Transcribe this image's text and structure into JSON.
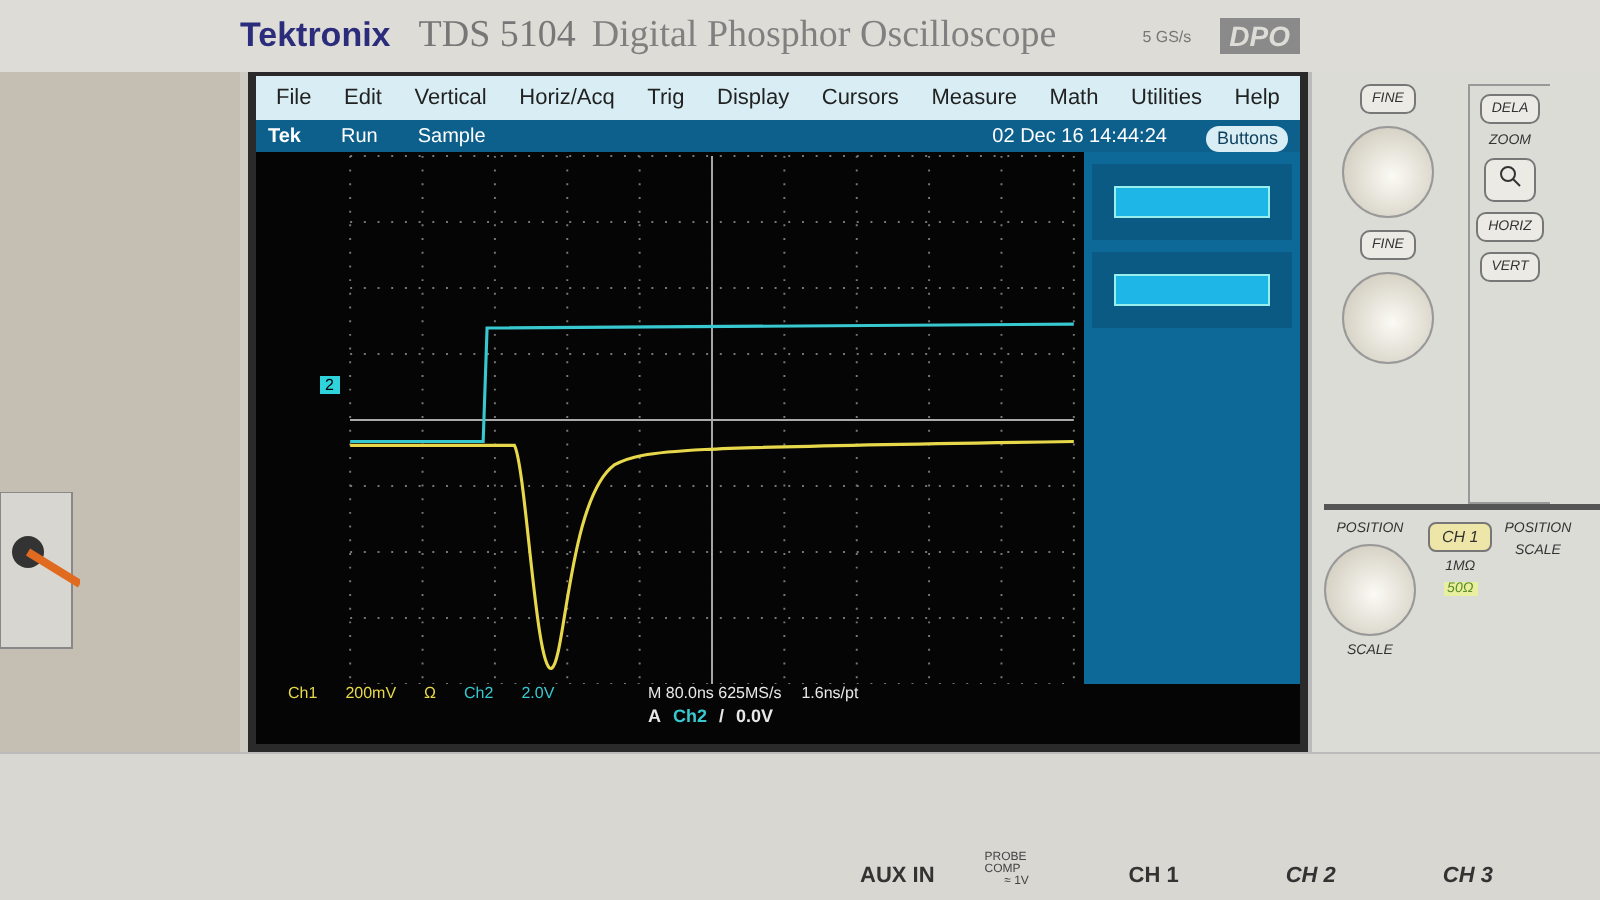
{
  "brand": {
    "logo": "Tektronix",
    "model": "TDS 5104",
    "title": "Digital Phosphor Oscilloscope",
    "rate": "5 GS/s",
    "badge": "DPO"
  },
  "menu": [
    "File",
    "Edit",
    "Vertical",
    "Horiz/Acq",
    "Trig",
    "Display",
    "Cursors",
    "Measure",
    "Math",
    "Utilities",
    "Help"
  ],
  "status": {
    "label": "Tek",
    "run": "Run",
    "mode": "Sample",
    "datetime": "02 Dec 16 14:44:24",
    "toggle": "Buttons"
  },
  "channel_marker": {
    "label": "2",
    "color": "#2fd3dc"
  },
  "traces": [
    {
      "kind": "step",
      "color": "#38c8d0"
    },
    {
      "kind": "pulse",
      "color": "#e6d84a"
    }
  ],
  "readout": {
    "vertical": [
      {
        "text": "Ch1",
        "color": "#e6d84a"
      },
      {
        "text": "200mV",
        "color": "#e6d84a"
      },
      {
        "text": "Ω",
        "color": "#e6d84a"
      },
      {
        "text": "Ch2",
        "color": "#38c8d0"
      },
      {
        "text": "2.0V",
        "color": "#38c8d0"
      }
    ],
    "timebase": [
      "M 80.0ns 625MS/s",
      "1.6ns/pt"
    ],
    "trigger": [
      {
        "text": "A",
        "color": "#e8e8e8"
      },
      {
        "text": "Ch2",
        "color": "#38c8d0"
      },
      {
        "text": "/",
        "color": "#e8e8e8"
      },
      {
        "text": "0.0V",
        "color": "#e8e8e8"
      }
    ]
  },
  "panel": {
    "fine_buttons": [
      "FINE",
      "FINE"
    ],
    "delay_button": "DELA",
    "zoom_label": "ZOOM",
    "zoom_buttons": [
      "HORIZ",
      "VERT"
    ],
    "channel": {
      "position": "POSITION",
      "button": "CH 1",
      "impedance": "1MΩ",
      "termination": "50Ω",
      "scale": "SCALE"
    },
    "channel_2": {
      "position": "POSITION",
      "scale": "SCALE"
    }
  },
  "ports": [
    "AUX IN",
    "PROBE COMP",
    "≈ 1V",
    "CH 1",
    "CH 2",
    "CH 3"
  ]
}
